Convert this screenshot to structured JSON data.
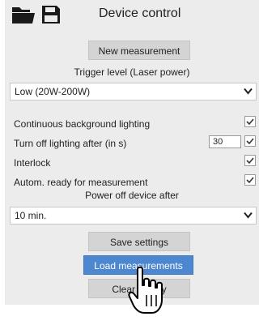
{
  "header": {
    "title": "Device control",
    "icons": {
      "open": "folder-icon",
      "save": "save-icon"
    }
  },
  "buttons": {
    "new_measurement": "New measurement",
    "save_settings": "Save settings",
    "load_measurements": "Load measurements",
    "clear": "Clear history"
  },
  "trigger": {
    "label": "Trigger level (Laser power)",
    "selected": "Low (20W-200W)"
  },
  "options": [
    {
      "label": "Continuous background lighting",
      "checked": true
    },
    {
      "label": "Turn off lighting after (in s)",
      "value": "30",
      "checked": true
    },
    {
      "label": "Interlock",
      "checked": true
    },
    {
      "label": "Autom. ready for measurement",
      "checked": true
    }
  ],
  "power_off": {
    "label": "Power off device after",
    "selected": "10 min."
  },
  "colors": {
    "panel": "#ececec",
    "button": "#d4d4d4",
    "primary": "#4d87cf"
  }
}
